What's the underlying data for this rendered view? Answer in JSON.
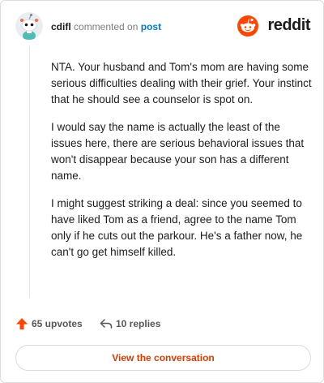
{
  "header": {
    "username": "cdifl",
    "verb": "commented on",
    "link": "post",
    "avatar_icon": "snoo-avatar-icon",
    "brand_icon": "reddit-alien-icon",
    "brand_text": "reddit"
  },
  "comment": {
    "paragraphs": [
      "NTA. Your husband and Tom's mom are having some serious difficulties dealing with their grief. Your instinct that he should see a counselor is spot on.",
      "I would say the name is actually the least of the issues here, there are serious behavioral issues that won't disappear because your son has a different name.",
      "I might suggest striking a deal: since you seemed to have liked Tom as a friend, agree to the name Tom only if he cuts out the parkour. He's a father now, he can't go get himself killed."
    ]
  },
  "actions": {
    "upvotes": "65 upvotes",
    "upvote_icon": "upvote-arrow-icon",
    "replies": "10 replies",
    "reply_icon": "reply-arrow-icon"
  },
  "cta": {
    "label": "View the conversation"
  },
  "colors": {
    "accent": "#ff4500",
    "link": "#0079d3",
    "cta_text": "#d93a00",
    "border": "#dcdcdc"
  }
}
